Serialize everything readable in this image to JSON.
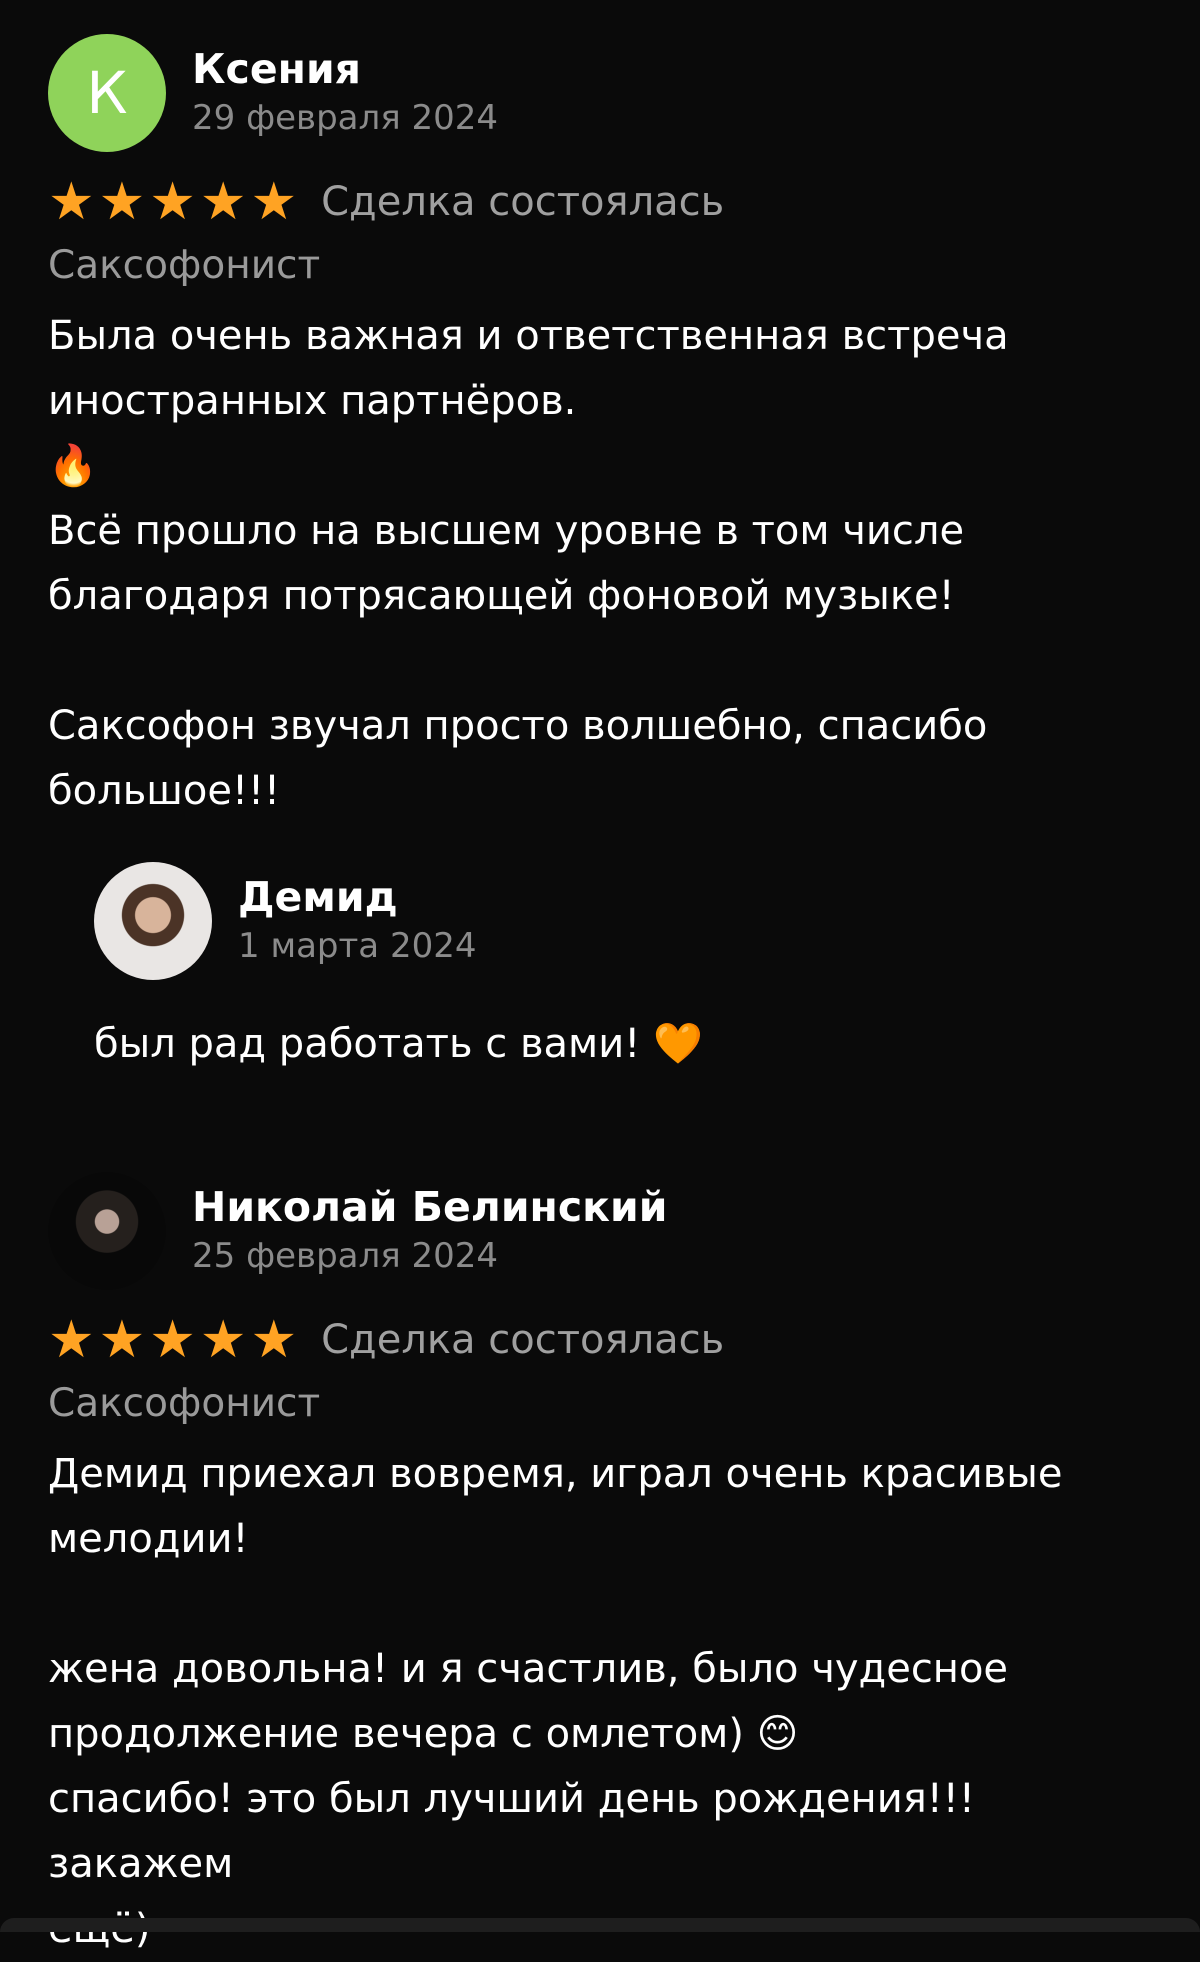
{
  "reviews": [
    {
      "avatar_letter": "К",
      "name": "Ксения",
      "date": "29 февраля 2024",
      "stars": 5,
      "deal_status": "Сделка состоялась",
      "category": "Саксофонист",
      "text": "Была очень важная и ответственная встреча\nиностранных партнёров.\n🔥\nВсё прошло на высшем уровне в том числе\nблагодаря потрясающей фоновой музыке!\n\nСаксофон звучал просто волшебно, спасибо\nбольшое!!!",
      "reply": {
        "name": "Демид",
        "date": "1 марта 2024",
        "text": "был рад работать с вами! 🧡"
      }
    },
    {
      "name": "Николай Белинский",
      "date": "25 февраля 2024",
      "stars": 5,
      "deal_status": "Сделка состоялась",
      "category": "Саксофонист",
      "text": "Демид приехал вовремя, играл очень красивые\nмелодии!\n\nжена довольна! и я счастлив, было чудесное\nпродолжение вечера с омлетом) 😊\nспасибо! это был лучший день рождения!!! закажем\nещё)"
    }
  ],
  "colors": {
    "background": "#0a0a0a",
    "star": "#ffa323",
    "avatar_green": "#8fd35a",
    "secondary_text": "#8b8b8b"
  },
  "icons": {
    "star": "★"
  }
}
